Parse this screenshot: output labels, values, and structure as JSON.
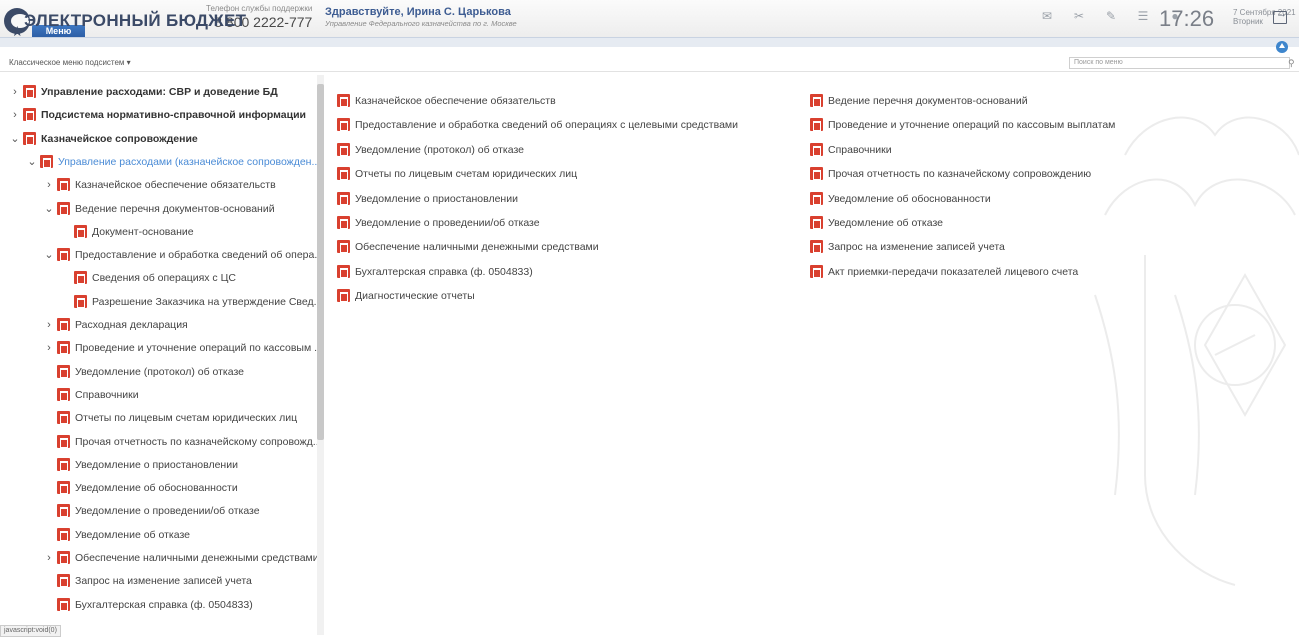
{
  "header": {
    "logo": "ЭЛЕКТРОННЫЙ БЮДЖЕТ",
    "support_label": "Телефон службы поддержки",
    "support_phone": "8 800 2222-777",
    "greeting": "Здравствуйте, Ирина С. Царькова",
    "organization": "Управление Федерального казначейства по г. Москве",
    "time": "17:26",
    "date": "7 Сентября 2021",
    "weekday": "Вторник",
    "menu_tab": "Меню"
  },
  "subbar": {
    "classic_menu": "Классическое меню подсистем ▾",
    "search_placeholder": "Поиск по меню"
  },
  "tree": [
    {
      "label": "Управление расходами: СВР и доведение БД",
      "caret": "›",
      "bold": true
    },
    {
      "label": "Подсистема нормативно-справочной информации",
      "caret": "›",
      "bold": true
    },
    {
      "label": "Казначейское сопровождение",
      "caret": "⌄",
      "bold": true
    },
    {
      "label": "Управление расходами (казначейское сопровожден...",
      "caret": "⌄",
      "active": true
    },
    {
      "label": "Казначейское обеспечение обязательств",
      "caret": "›"
    },
    {
      "label": "Ведение перечня документов-оснований",
      "caret": "⌄"
    },
    {
      "label": "Документ-основание",
      "caret": ""
    },
    {
      "label": "Предоставление и обработка сведений об опера...",
      "caret": "⌄"
    },
    {
      "label": "Сведения об операциях с ЦС",
      "caret": ""
    },
    {
      "label": "Разрешение Заказчика на утверждение Свед...",
      "caret": ""
    },
    {
      "label": "Расходная декларация",
      "caret": "›"
    },
    {
      "label": "Проведение и уточнение операций по кассовым ...",
      "caret": "›"
    },
    {
      "label": "Уведомление (протокол) об отказе",
      "caret": ""
    },
    {
      "label": "Справочники",
      "caret": ""
    },
    {
      "label": "Отчеты по лицевым счетам юридических лиц",
      "caret": ""
    },
    {
      "label": "Прочая отчетность по казначейскому сопровожд...",
      "caret": ""
    },
    {
      "label": "Уведомление о приостановлении",
      "caret": ""
    },
    {
      "label": "Уведомление об обоснованности",
      "caret": ""
    },
    {
      "label": "Уведомление о проведении/об отказе",
      "caret": ""
    },
    {
      "label": "Уведомление об отказе",
      "caret": ""
    },
    {
      "label": "Обеспечение наличными денежными средствами",
      "caret": "›"
    },
    {
      "label": "Запрос на изменение записей учета",
      "caret": ""
    },
    {
      "label": "Бухгалтерская справка (ф. 0504833)",
      "caret": ""
    }
  ],
  "main_left": [
    "Казначейское обеспечение обязательств",
    "Предоставление и обработка сведений об операциях с целевыми средствами",
    "Уведомление (протокол) об отказе",
    "Отчеты по лицевым счетам юридических лиц",
    "Уведомление о приостановлении",
    "Уведомление о проведении/об отказе",
    "Обеспечение наличными денежными средствами",
    "Бухгалтерская справка (ф. 0504833)",
    "Диагностические отчеты"
  ],
  "main_right": [
    "Ведение перечня документов-оснований",
    "Проведение и уточнение операций по кассовым выплатам",
    "Справочники",
    "Прочая отчетность по казначейскому сопровождению",
    "Уведомление об обоснованности",
    "Уведомление об отказе",
    "Запрос на изменение записей учета",
    "Акт приемки-передачи показателей лицевого счета"
  ],
  "status_text": "javascript:void(0)"
}
